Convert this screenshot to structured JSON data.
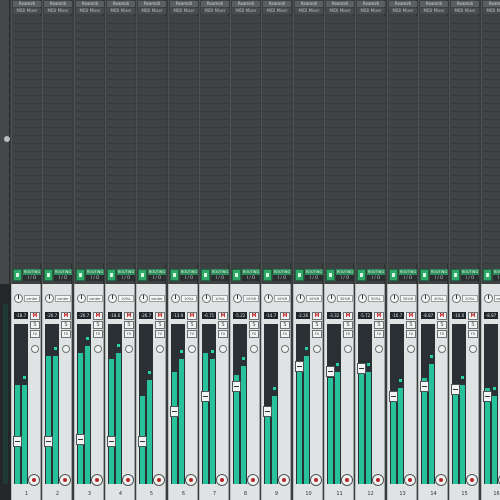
{
  "app": {
    "accent": "#2fa868",
    "meter_color": "#27c29c",
    "record_color": "#b72727"
  },
  "icons": {
    "route": "route-icon",
    "pan": "pan-knob-icon",
    "phase": "phase-icon",
    "record": "record-arm-icon"
  },
  "channels": [
    {
      "number": "1",
      "name": "Reamidi",
      "input": "MIDI Mixer",
      "top_label": "ROUTING",
      "io": "I / O",
      "pan": "center",
      "volume": "-18.7",
      "mute": "M",
      "solo": "S",
      "fx": "FX",
      "meter_l": 0.62,
      "meter_r": 0.62,
      "fader": 0.25
    },
    {
      "number": "2",
      "name": "Reamidi",
      "input": "MIDI Mixer",
      "top_label": "ROUTING",
      "io": "I / O",
      "pan": "center",
      "volume": "-26.7",
      "mute": "M",
      "solo": "S",
      "fx": "FX",
      "meter_l": 0.8,
      "meter_r": 0.8,
      "fader": 0.25
    },
    {
      "number": "3",
      "name": "Reamidi",
      "input": "MIDI Mixer",
      "top_label": "ROUTING",
      "io": "I / O",
      "pan": "center",
      "volume": "-26.7",
      "mute": "M",
      "solo": "S",
      "fx": "FX",
      "meter_l": 0.82,
      "meter_r": 0.86,
      "fader": 0.26
    },
    {
      "number": "4",
      "name": "Reamidi",
      "input": "MIDI Mixer",
      "top_label": "ROUTING",
      "io": "I / O",
      "pan": "10%L",
      "volume": "-18.6",
      "mute": "M",
      "solo": "S",
      "fx": "FX",
      "meter_l": 0.78,
      "meter_r": 0.82,
      "fader": 0.25
    },
    {
      "number": "5",
      "name": "Reamidi",
      "input": "MIDI Mixer",
      "top_label": "ROUTING",
      "io": "I / O",
      "pan": "center",
      "volume": "-26.7",
      "mute": "M",
      "solo": "S",
      "fx": "FX",
      "meter_l": 0.55,
      "meter_r": 0.65,
      "fader": 0.25
    },
    {
      "number": "6",
      "name": "Reamidi",
      "input": "MIDI Mixer",
      "top_label": "ROUTING",
      "io": "I / O",
      "pan": "10%L",
      "volume": "-13.9",
      "mute": "M",
      "solo": "S",
      "fx": "FX",
      "meter_l": 0.7,
      "meter_r": 0.78,
      "fader": 0.45
    },
    {
      "number": "7",
      "name": "Reamidi",
      "input": "MIDI Mixer",
      "top_label": "ROUTING",
      "io": "I / O",
      "pan": "10%L",
      "volume": "-6.71",
      "mute": "M",
      "solo": "S",
      "fx": "FX",
      "meter_l": 0.82,
      "meter_r": 0.78,
      "fader": 0.55
    },
    {
      "number": "8",
      "name": "Reamidi",
      "input": "MIDI Mixer",
      "top_label": "ROUTING",
      "io": "I / O",
      "pan": "10%R",
      "volume": "-5.22",
      "mute": "M",
      "solo": "S",
      "fx": "FX",
      "meter_l": 0.68,
      "meter_r": 0.74,
      "fader": 0.62
    },
    {
      "number": "9",
      "name": "Reamidi",
      "input": "MIDI Mixer",
      "top_label": "ROUTING",
      "io": "I / O",
      "pan": "10%R",
      "volume": "-14.7",
      "mute": "M",
      "solo": "S",
      "fx": "FX",
      "meter_l": 0.48,
      "meter_r": 0.55,
      "fader": 0.45
    },
    {
      "number": "10",
      "name": "Reamidi",
      "input": "MIDI Mixer",
      "top_label": "ROUTING",
      "io": "I / O",
      "pan": "10%R",
      "volume": "-2.26",
      "mute": "M",
      "solo": "S",
      "fx": "FX",
      "meter_l": 0.75,
      "meter_r": 0.8,
      "fader": 0.75
    },
    {
      "number": "11",
      "name": "Reamidi",
      "input": "MIDI Mixer",
      "top_label": "ROUTING",
      "io": "I / O",
      "pan": "30%R",
      "volume": "-3.32",
      "mute": "M",
      "solo": "S",
      "fx": "FX",
      "meter_l": 0.66,
      "meter_r": 0.7,
      "fader": 0.72
    },
    {
      "number": "12",
      "name": "Reamidi",
      "input": "MIDI Mixer",
      "top_label": "ROUTING",
      "io": "I / O",
      "pan": "50%L",
      "volume": "-5.72",
      "mute": "M",
      "solo": "S",
      "fx": "FX",
      "meter_l": 0.72,
      "meter_r": 0.7,
      "fader": 0.74
    },
    {
      "number": "13",
      "name": "Reamidi",
      "input": "MIDI Mixer",
      "top_label": "ROUTING",
      "io": "I / O",
      "pan": "30%R",
      "volume": "-16.7",
      "mute": "M",
      "solo": "S",
      "fx": "FX",
      "meter_l": 0.55,
      "meter_r": 0.6,
      "fader": 0.55
    },
    {
      "number": "14",
      "name": "Reamidi",
      "input": "MIDI Mixer",
      "top_label": "ROUTING",
      "io": "I / O",
      "pan": "40%L",
      "volume": "-8.87",
      "mute": "M",
      "solo": "S",
      "fx": "FX",
      "meter_l": 0.66,
      "meter_r": 0.75,
      "fader": 0.62
    },
    {
      "number": "15",
      "name": "Reamidi",
      "input": "MIDI Mixer",
      "top_label": "ROUTING",
      "io": "I / O",
      "pan": "20%L",
      "volume": "-10.0",
      "mute": "M",
      "solo": "S",
      "fx": "FX",
      "meter_l": 0.58,
      "meter_r": 0.62,
      "fader": 0.6
    },
    {
      "number": "16",
      "name": "Reamidi",
      "input": "MIDI Mixer",
      "top_label": "ROUTING",
      "io": "I / O",
      "pan": "center",
      "volume": "-8.87",
      "mute": "M",
      "solo": "S",
      "fx": "FX",
      "meter_l": 0.6,
      "meter_r": 0.55,
      "fader": 0.55
    }
  ]
}
